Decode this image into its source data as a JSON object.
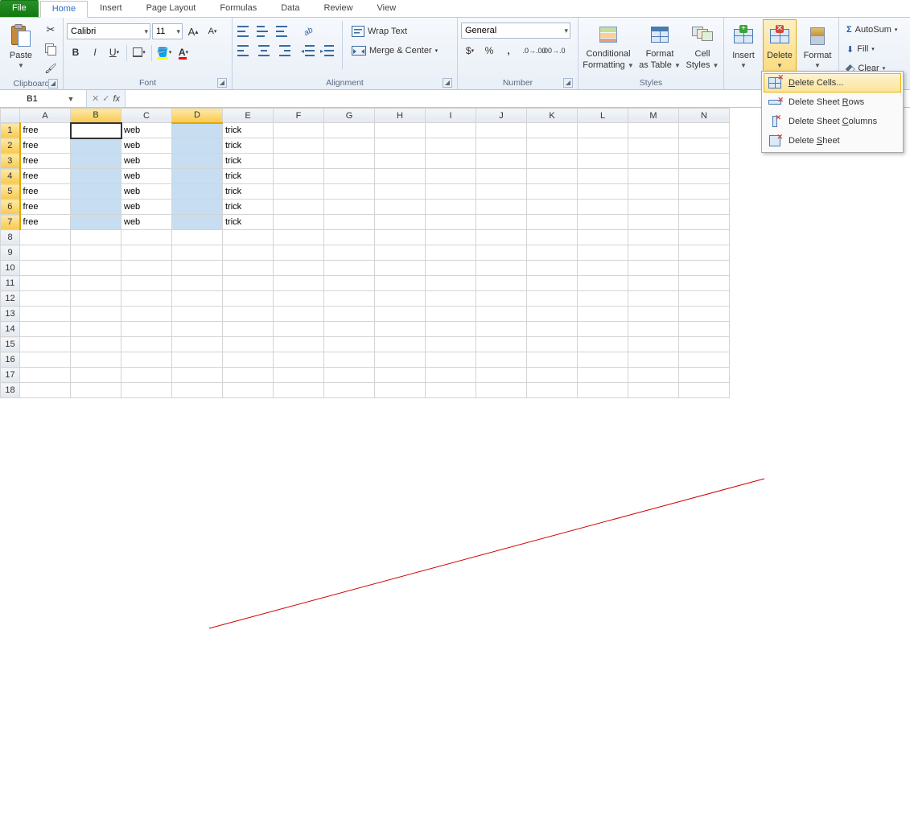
{
  "tabs": {
    "file": "File",
    "home": "Home",
    "insert": "Insert",
    "page_layout": "Page Layout",
    "formulas": "Formulas",
    "data": "Data",
    "review": "Review",
    "view": "View"
  },
  "ribbon": {
    "clipboard": {
      "paste": "Paste",
      "label": "Clipboard"
    },
    "font": {
      "name": "Calibri",
      "size": "11",
      "label": "Font"
    },
    "alignment": {
      "wrap": "Wrap Text",
      "merge": "Merge & Center",
      "label": "Alignment"
    },
    "number": {
      "format": "General",
      "label": "Number"
    },
    "styles": {
      "cond": "Conditional",
      "cond2": "Formatting",
      "fmt": "Format",
      "fmt2": "as Table",
      "cell": "Cell",
      "cell2": "Styles",
      "label": "Styles"
    },
    "cells": {
      "insert": "Insert",
      "delete": "Delete",
      "format": "Format"
    },
    "editing": {
      "autosum": "AutoSum",
      "fill": "Fill",
      "clear": "Clear"
    }
  },
  "namebox": "B1",
  "formula": "",
  "fx": "fx",
  "columns": [
    "A",
    "B",
    "C",
    "D",
    "E",
    "F",
    "G",
    "H",
    "I",
    "J",
    "K",
    "L",
    "M",
    "N"
  ],
  "selected_cols": [
    "B",
    "D"
  ],
  "rows": 18,
  "data_rows": 7,
  "cells": {
    "A": "free",
    "C": "web",
    "E": "trick"
  },
  "menu": {
    "delete_cells_pre": "",
    "delete_cells_u": "D",
    "delete_cells_post": "elete Cells...",
    "delete_rows_pre": "Delete Sheet ",
    "delete_rows_u": "R",
    "delete_rows_post": "ows",
    "delete_cols_pre": "Delete Sheet ",
    "delete_cols_u": "C",
    "delete_cols_post": "olumns",
    "delete_sheet_pre": "Delete ",
    "delete_sheet_u": "S",
    "delete_sheet_post": "heet"
  }
}
